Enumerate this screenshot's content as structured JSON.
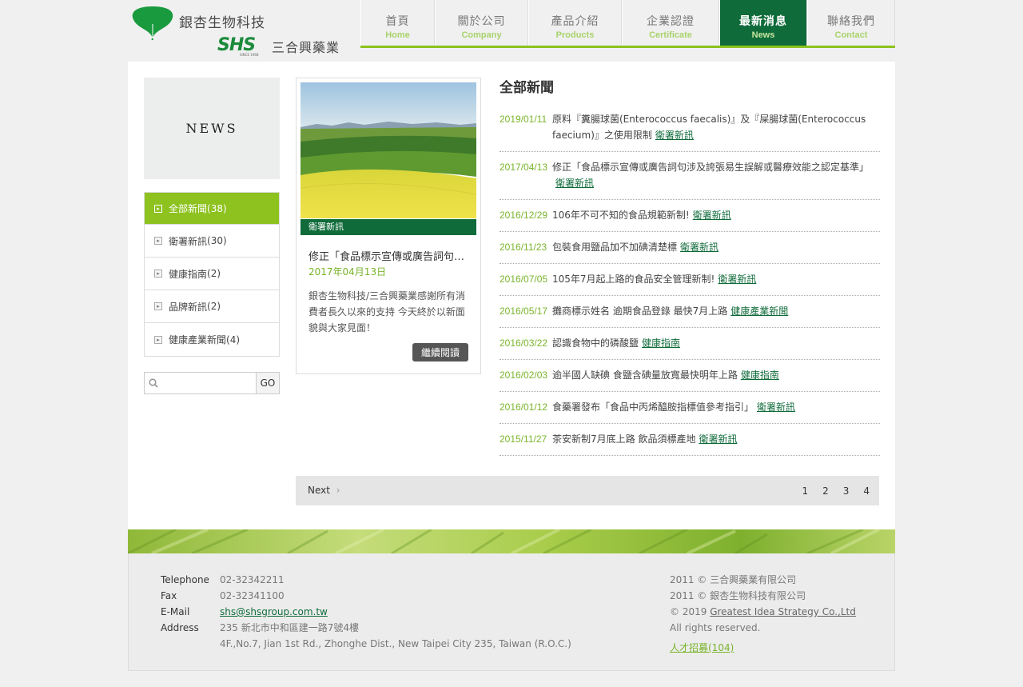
{
  "brand": {
    "name_top": "銀杏生物科技",
    "shs_logo": "SHS",
    "shs_since": "SINCE 1968",
    "name_bottom": "三合興藥業",
    "colors": {
      "green_dark": "#0f6b3a",
      "green_light": "#8dc21f",
      "text_green": "#7ab42b"
    }
  },
  "nav": [
    {
      "zh": "首頁",
      "en": "Home",
      "active": false
    },
    {
      "zh": "關於公司",
      "en": "Company",
      "active": false
    },
    {
      "zh": "產品介紹",
      "en": "Products",
      "active": false
    },
    {
      "zh": "企業認證",
      "en": "Certificate",
      "active": false
    },
    {
      "zh": "最新消息",
      "en": "News",
      "active": true
    },
    {
      "zh": "聯絡我們",
      "en": "Contact",
      "active": false
    }
  ],
  "sidebar": {
    "banner": "NEWS",
    "categories": [
      {
        "label": "全部新聞",
        "count": "(38)",
        "active": true
      },
      {
        "label": "衛署新訊",
        "count": "(30)",
        "active": false
      },
      {
        "label": "健康指南",
        "count": "(2)",
        "active": false
      },
      {
        "label": "品牌新訊",
        "count": "(2)",
        "active": false
      },
      {
        "label": "健康產業新聞",
        "count": "(4)",
        "active": false
      }
    ],
    "search": {
      "placeholder": "",
      "button": "GO"
    }
  },
  "featured": {
    "tag": "衛署新訊",
    "title": "修正「食品標示宣傳或廣告詞句涉及誇張易生誤解或醫療效能之認定基準」",
    "date": "2017年04月13日",
    "description": "銀杏生物科技/三合興藥業感謝所有消費者長久以來的支持 今天終於以新面貌與大家見面！",
    "button": "繼續閱讀"
  },
  "news": {
    "heading": "全部新聞",
    "items": [
      {
        "date": "2019/01/11",
        "title": "原料『糞腸球菌(Enterococcus faecalis)』及『屎腸球菌(Enterococcus faecium)』之使用限制",
        "category": "衛署新訊"
      },
      {
        "date": "2017/04/13",
        "title": "修正「食品標示宣傳或廣告詞句涉及誇張易生誤解或醫療效能之認定基準」",
        "category": "衛署新訊"
      },
      {
        "date": "2016/12/29",
        "title": "106年不可不知的食品規範新制!",
        "category": "衛署新訊"
      },
      {
        "date": "2016/11/23",
        "title": "包裝食用鹽品加不加碘清楚標",
        "category": "衛署新訊"
      },
      {
        "date": "2016/07/05",
        "title": "105年7月起上路的食品安全管理新制!",
        "category": "衛署新訊"
      },
      {
        "date": "2016/05/17",
        "title": "攤商標示姓名 逾期食品登錄 最快7月上路",
        "category": "健康產業新聞"
      },
      {
        "date": "2016/03/22",
        "title": "認識食物中的磷酸鹽",
        "category": "健康指南"
      },
      {
        "date": "2016/02/03",
        "title": "逾半國人缺碘 食鹽含碘量放寬最快明年上路",
        "category": "健康指南"
      },
      {
        "date": "2016/01/12",
        "title": "食藥署發布「食品中丙烯醯胺指標值參考指引」",
        "category": "衛署新訊"
      },
      {
        "date": "2015/11/27",
        "title": "茶安新制7月底上路 飲品須標產地",
        "category": "衛署新訊"
      }
    ]
  },
  "pager": {
    "next": "Next",
    "pages": [
      "1",
      "2",
      "3",
      "4"
    ]
  },
  "footer": {
    "contact": [
      {
        "label": "Telephone",
        "value": "02-32342211"
      },
      {
        "label": "Fax",
        "value": "02-32341100"
      },
      {
        "label": "E-Mail",
        "value": "shs@shsgroup.com.tw"
      },
      {
        "label": "Address",
        "value": "235 新北市中和區建一路7號4樓"
      }
    ],
    "address_en": "4F.,No.7, Jian 1st Rd., Zhonghe Dist., New Taipei City 235, Taiwan (R.O.C.)",
    "copyright_1": "2011 © 三合興藥業有限公司",
    "copyright_2": "2011 © 銀杏生物科技有限公司",
    "copyright_3_prefix": "© 2019",
    "copyright_3_link": "Greatest Idea Strategy Co.,Ltd",
    "copyright_3_suffix": "All rights reserved.",
    "jobs": "人才招募(104)"
  }
}
